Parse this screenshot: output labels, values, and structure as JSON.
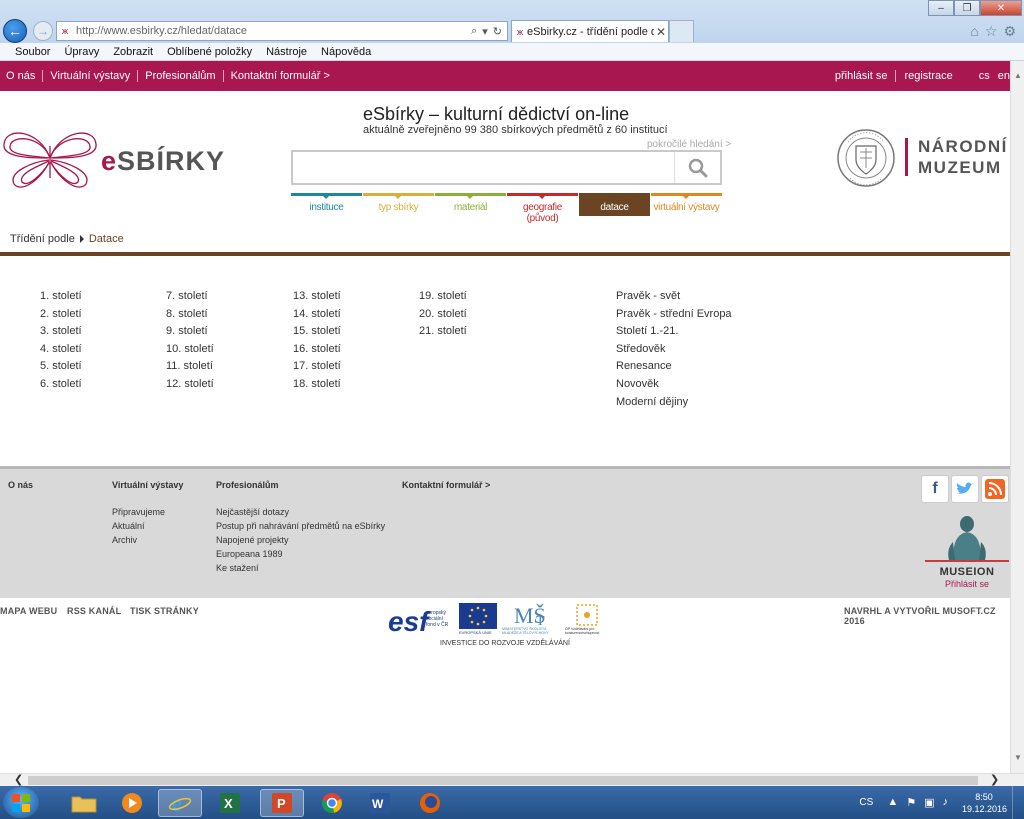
{
  "browser": {
    "url": "http://www.esbirky.cz/hledat/datace",
    "tab_title": "eSbirky.cz - třídění podle da...",
    "menu": [
      "Soubor",
      "Úpravy",
      "Zobrazit",
      "Oblíbené položky",
      "Nástroje",
      "Nápověda"
    ]
  },
  "topbar": {
    "left_links": [
      "O nás",
      "Virtuální výstavy",
      "Profesionálům",
      "Kontaktní formulář >"
    ],
    "login": "přihlásit se",
    "register": "registrace",
    "lang_cs": "cs",
    "lang_en": "en"
  },
  "header": {
    "logo_text_e": "e",
    "logo_text_rest": "SBÍRKY",
    "title": "eSbírky – kulturní dědictví on-line",
    "subtitle": "aktuálně zveřejněno 99 380 sbírkových předmětů z 60 institucí",
    "advanced_search": "pokročilé hledání >",
    "search_value": "",
    "museum_line1": "NÁRODNÍ",
    "museum_line2": "MUZEUM",
    "categories": [
      {
        "label": "instituce",
        "color": "#1a8a9a"
      },
      {
        "label": "typ sbírky",
        "color": "#d6b03c"
      },
      {
        "label": "materiál",
        "color": "#8ab03a"
      },
      {
        "label": "geografie (původ)",
        "color": "#c62a2a"
      },
      {
        "label": "datace",
        "color": "#6b4423"
      },
      {
        "label": "virtuální výstavy",
        "color": "#e0871e"
      }
    ],
    "active_category": "datace"
  },
  "breadcrumb": {
    "parent": "Třídění podle",
    "current": "Datace"
  },
  "centuries": {
    "col1": [
      "1. století",
      "2. století",
      "3. století",
      "4. století",
      "5. století",
      "6. století"
    ],
    "col2": [
      "7. století",
      "8. století",
      "9. století",
      "10. století",
      "11. století",
      "12. století"
    ],
    "col3": [
      "13. století",
      "14. století",
      "15. století",
      "16. století",
      "17. století",
      "18. století"
    ],
    "col4": [
      "19. století",
      "20. století",
      "21. století"
    ]
  },
  "eras": [
    "Pravěk - svět",
    "Pravěk - střední Evropa",
    "Století 1.-21.",
    "Středověk",
    "Renesance",
    "Novověk",
    "Moderní dějiny"
  ],
  "footer": {
    "col1_head": "O nás",
    "col2_head": "Virtuální výstavy",
    "col2_items": [
      "Připravujeme",
      "Aktuální",
      "Archiv"
    ],
    "col3_head": "Profesionálům",
    "col3_items": [
      "Nejčastější dotazy",
      "Postup při nahrávání předmětů na eSbírky",
      "Napojené projekty",
      "Europeana 1989",
      "Ke stažení"
    ],
    "col4_head": "Kontaktní formulář >",
    "musion_name": "MUSEION",
    "musion_login": "Přihlásit se",
    "bottom_links": [
      "MAPA WEBU",
      "RSS KANÁL",
      "TISK STRÁNKY"
    ],
    "credit": "NAVRHL A VYTVOŘIL MUSOFT.CZ 2016",
    "eu_caption": "INVESTICE DO ROZVOJE VZDĚLÁVÁNÍ",
    "esf_text": "evropský sociální fond v ČR",
    "eu_text": "EVROPSKÁ UNIE",
    "msmt_text": "MINISTERSTVO ŠKOLSTVÍ, MLÁDEŽE A TĚLOVÝCHOVY",
    "op_text": "OP Vzdělávání pro konkurenceschopnost"
  },
  "taskbar": {
    "lang": "CS",
    "time": "8:50",
    "date": "19.12.2016"
  },
  "colors": {
    "brand": "#a8174f",
    "datace_brown": "#6b4423",
    "footer_bg": "#d9d9d9"
  }
}
